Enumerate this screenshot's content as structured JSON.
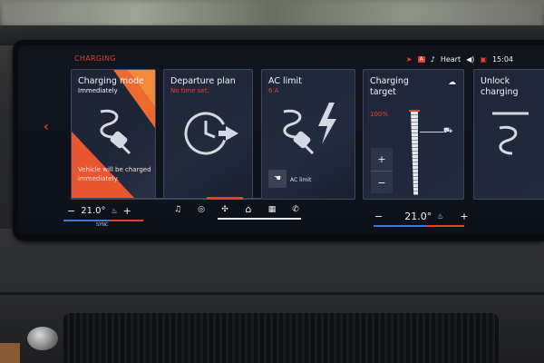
{
  "header": {
    "section": "CHARGING"
  },
  "status_bar": {
    "nav_icon": "navigation-arrow-icon",
    "badge": "A",
    "music_icon": "music-icon",
    "now_playing": "Heart",
    "volume_icon": "speaker-icon",
    "calendar_icon": "calendar-icon",
    "time": "15:04"
  },
  "nav_back": {
    "icon": "chevron-left-icon",
    "glyph": "‹"
  },
  "cards": [
    {
      "id": "charging-mode",
      "title": "Charging mode",
      "subtitle": "Immediately",
      "note": "Vehicle will be charged immediately.",
      "icon": "charge-plug-icon"
    },
    {
      "id": "departure-plan",
      "title": "Departure plan",
      "subtitle": "No time set.",
      "icon": "clock-arrow-icon"
    },
    {
      "id": "ac-limit",
      "title": "AC limit",
      "subtitle": "6 A",
      "icon": "plug-lightning-icon",
      "button_label": "AC limit"
    },
    {
      "id": "charging-target",
      "title": "Charging target",
      "subtitle": "100%",
      "icon": "cloud-icon",
      "level_percent": 100,
      "plus": "+",
      "minus": "−"
    },
    {
      "id": "unlock-charging",
      "title": "Unlock charging",
      "icon": "plug-unlock-icon"
    }
  ],
  "climate_left": {
    "minus": "−",
    "temp": "21.0°",
    "plus": "+",
    "sync": "SYNC",
    "seat_icon": "seat-heat-icon"
  },
  "climate_right": {
    "minus": "−",
    "temp": "21.0°",
    "plus": "+",
    "seat_icon": "seat-heat-icon"
  },
  "nav_bar": [
    {
      "id": "media",
      "icon": "music-note-icon",
      "glyph": "♫"
    },
    {
      "id": "assistant",
      "icon": "assistant-icon",
      "glyph": "◎"
    },
    {
      "id": "climate",
      "icon": "fan-icon",
      "glyph": "✣"
    },
    {
      "id": "home",
      "icon": "home-icon",
      "glyph": "⌂",
      "active": true
    },
    {
      "id": "apps",
      "icon": "apps-grid-icon",
      "glyph": "▦"
    },
    {
      "id": "phone",
      "icon": "phone-icon",
      "glyph": "✆"
    }
  ],
  "colors": {
    "accent": "#e6402b",
    "card_bg": "#1d2436",
    "orange": "#ea6a2f",
    "blue": "#3a7ad8"
  }
}
